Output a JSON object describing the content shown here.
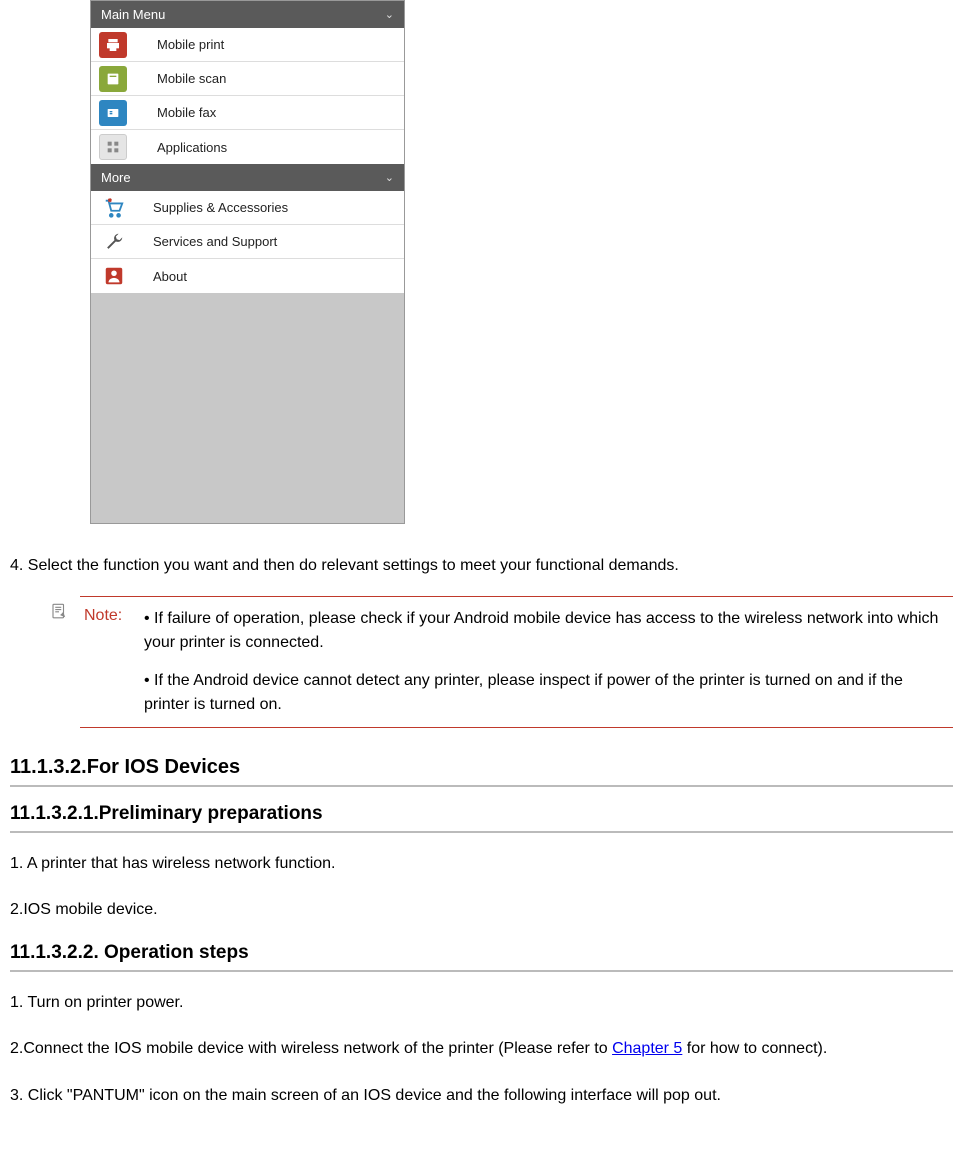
{
  "screenshot": {
    "mainMenuTitle": "Main Menu",
    "mainItems": [
      {
        "label": "Mobile print",
        "iconColor": "red",
        "iconName": "print-icon"
      },
      {
        "label": "Mobile scan",
        "iconColor": "green",
        "iconName": "scan-icon"
      },
      {
        "label": "Mobile fax",
        "iconColor": "blue",
        "iconName": "fax-icon"
      },
      {
        "label": "Applications",
        "iconColor": "gray",
        "iconName": "apps-icon"
      }
    ],
    "moreTitle": "More",
    "moreItems": [
      {
        "label": "Supplies & Accessories",
        "iconName": "cart-icon"
      },
      {
        "label": "Services and Support",
        "iconName": "wrench-icon"
      },
      {
        "label": "About",
        "iconName": "person-icon"
      }
    ]
  },
  "step4": "4. Select the function you want and then do relevant settings to meet your functional demands.",
  "note": {
    "label": "Note:",
    "bullet1": "• If failure of operation, please check if your Android mobile device has access to the wireless network into which your printer is connected.",
    "bullet2": "• If the Android device cannot detect any printer, please inspect if power of the printer is turned on and if the printer is turned on."
  },
  "headings": {
    "h1": "11.1.3.2.For IOS Devices",
    "h2": "11.1.3.2.1.Preliminary preparations",
    "h3": "11.1.3.2.2. Operation steps"
  },
  "prep": {
    "p1": "1. A printer that has wireless network function.",
    "p2": "2.IOS mobile device."
  },
  "ops": {
    "p1": "1. Turn on printer power.",
    "p2a": "2.Connect the IOS mobile device with wireless network of the printer (Please refer to ",
    "p2link": "Chapter 5",
    "p2b": " for how to connect).",
    "p3": "3. Click \"PANTUM\" icon on the main screen of an IOS device and the following interface will pop out."
  }
}
